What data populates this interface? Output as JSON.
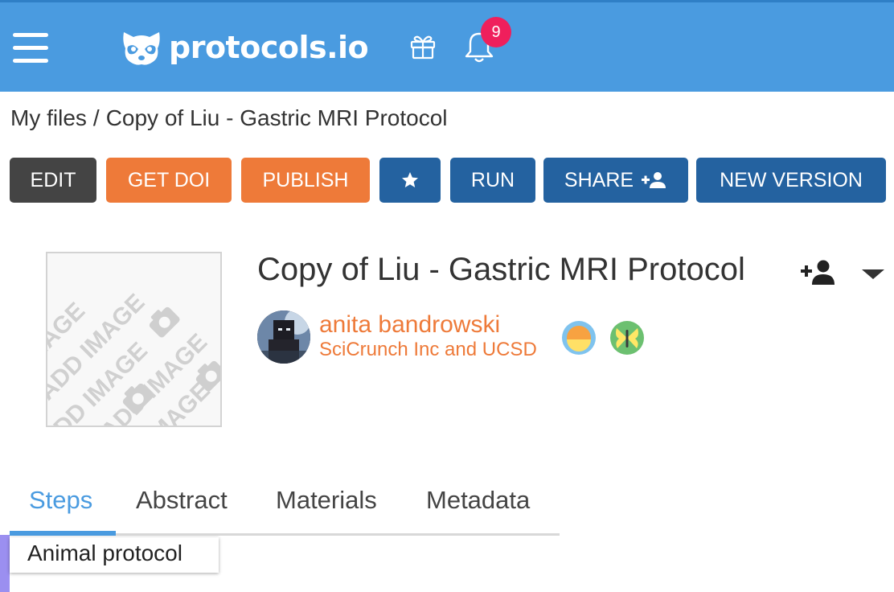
{
  "header": {
    "brand": "protocols.io",
    "notification_count": "9",
    "colors": {
      "bar": "#4a9be0",
      "badge": "#ef1f5c"
    },
    "icons": [
      "menu-icon",
      "raccoon-logo-icon",
      "gift-icon",
      "bell-icon"
    ]
  },
  "breadcrumb": {
    "root": "My files",
    "separator": "/",
    "current": "Copy of Liu - Gastric MRI Protocol"
  },
  "toolbar": {
    "edit": "EDIT",
    "get_doi": "GET DOI",
    "publish": "PUBLISH",
    "star_icon": "star-icon",
    "run": "RUN",
    "share": "SHARE",
    "share_icon": "add-person-icon",
    "new_version": "NEW VERSION",
    "colors": {
      "dark": "#444444",
      "orange": "#ee7a39",
      "blue": "#2462a0"
    }
  },
  "protocol": {
    "image_placeholder": "ADD IMAGE",
    "title": "Copy of Liu - Gastric MRI Protocol",
    "author": {
      "name": "anita bandrowski",
      "affiliation": "SciCrunch Inc and UCSD"
    }
  },
  "tabs": [
    {
      "label": "Steps",
      "active": true
    },
    {
      "label": "Abstract",
      "active": false
    },
    {
      "label": "Materials",
      "active": false
    },
    {
      "label": "Metadata",
      "active": false
    }
  ],
  "section_chip": "Animal protocol"
}
